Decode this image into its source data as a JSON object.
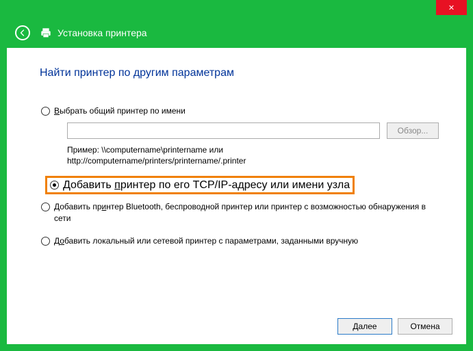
{
  "titlebar": {
    "close": "✕"
  },
  "header": {
    "title": "Установка принтера"
  },
  "main": {
    "heading": "Найти принтер по другим параметрам",
    "opt1_prefix": "В",
    "opt1_rest": "ыбрать общий принтер по имени",
    "browse": "Обзор...",
    "example_l1": "Пример: \\\\computername\\printername или",
    "example_l2": "http://computername/printers/printername/.printer",
    "opt2_pre": "Добавить ",
    "opt2_u": "п",
    "opt2_post": "ринтер по его TCP/IP-адресу или имени узла",
    "opt3_pre": "Добавить пр",
    "opt3_u": "и",
    "opt3_post": "нтер Bluetooth, беспроводной принтер или принтер с возможностью обнаружения в сети",
    "opt4_pre": "Д",
    "opt4_u": "о",
    "opt4_post": "бавить локальный или сетевой принтер с параметрами, заданными вручную"
  },
  "footer": {
    "next": "Далее",
    "cancel": "Отмена"
  },
  "input_value": ""
}
